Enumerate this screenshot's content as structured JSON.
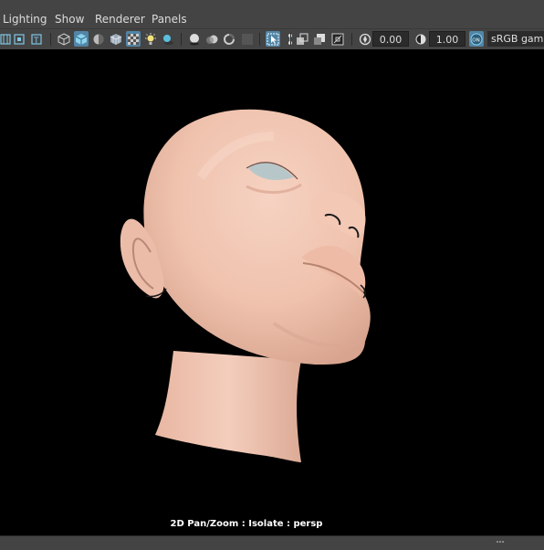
{
  "menubar": {
    "items": [
      "Lighting",
      "Show",
      "Renderer",
      "Panels"
    ]
  },
  "toolbar": {
    "exposure_value": "0.00",
    "gamma_value": "1.00",
    "color_space": "sRGB gamma",
    "accent_color": "#5285a6",
    "icons": [
      "grid-icon",
      "film-gate-icon",
      "text-icon",
      "wireframe-icon",
      "smooth-shade-icon",
      "default-material-icon",
      "shaded-wireframe-icon",
      "xray-icon",
      "all-lights-icon",
      "shadows-icon",
      "screen-space-ao-icon",
      "motion-blur-icon",
      "anti-alias-icon",
      "isolate-select-icon",
      "xray-joints-icon",
      "xray-active-icon",
      "gate-mask-icon",
      "exposure-icon",
      "gamma-icon",
      "color-management-on-icon"
    ]
  },
  "viewport": {
    "hud_text": "2D Pan/Zoom : Isolate : persp",
    "background": "#000000",
    "skin_color": "#f0c5b2"
  }
}
